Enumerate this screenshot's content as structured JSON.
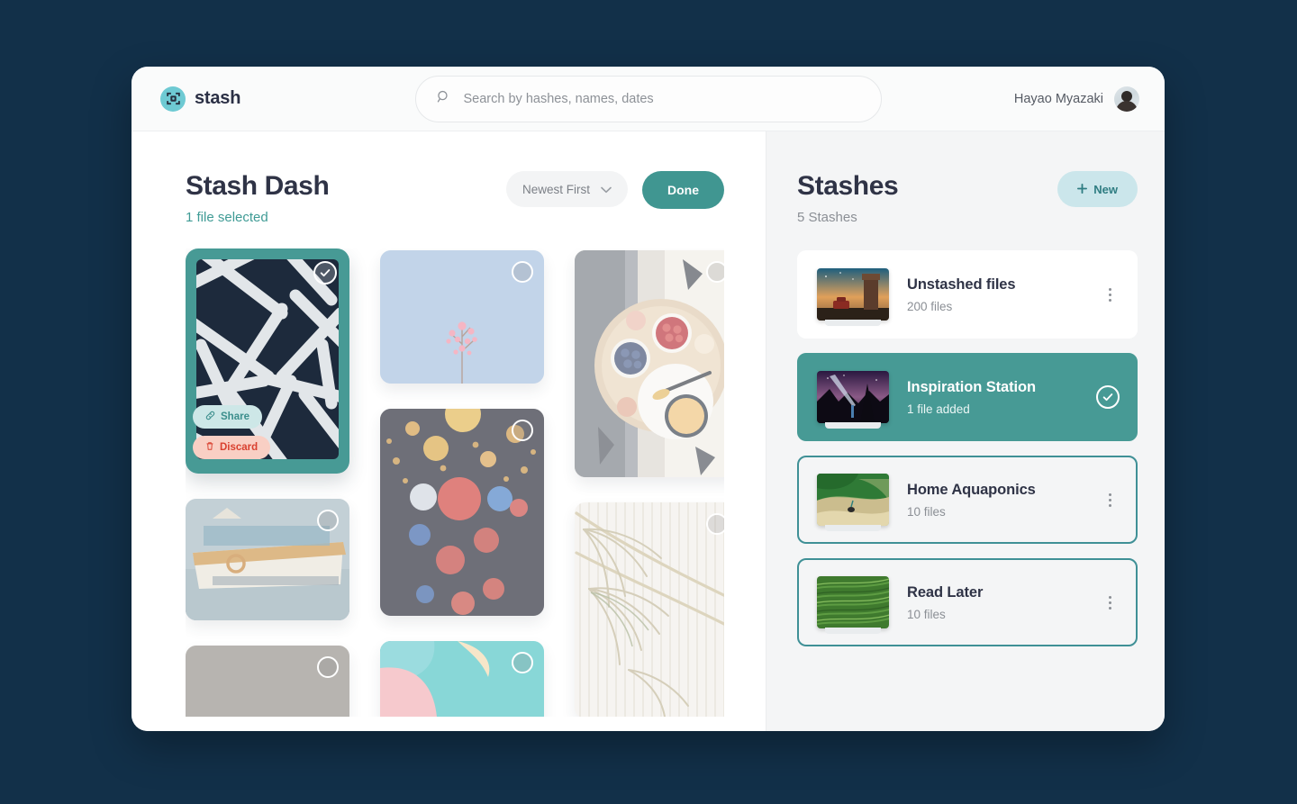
{
  "app": {
    "brand_name": "stash",
    "brand_icon": "stash-logo-icon"
  },
  "header": {
    "search": {
      "icon": "search-icon",
      "placeholder": "Search by hashes, names, dates",
      "value": ""
    },
    "user": {
      "name": "Hayao Myazaki",
      "avatar": "user-avatar"
    }
  },
  "dash": {
    "title": "Stash Dash",
    "subtitle": "1 file selected",
    "sort": {
      "label": "Newest First",
      "chevron": "chevron-down-icon"
    },
    "done_label": "Done",
    "selected_tile": {
      "check_icon": "check-circle-icon",
      "share_label": "Share",
      "share_icon": "link-icon",
      "discard_label": "Discard",
      "discard_icon": "trash-icon"
    },
    "tile_check_icon": "circle-unchecked-icon"
  },
  "stashes": {
    "title": "Stashes",
    "subtitle": "5 Stashes",
    "new_label": "New",
    "new_icon": "plus-icon",
    "menu_icon": "kebab-menu-icon",
    "selected_icon": "check-circle-icon",
    "items": [
      {
        "name": "Unstashed files",
        "count": "200 files",
        "state": "default"
      },
      {
        "name": "Inspiration Station",
        "count": "1 file added",
        "state": "active"
      },
      {
        "name": "Home Aquaponics",
        "count": "10 files",
        "state": "outlined"
      },
      {
        "name": "Read Later",
        "count": "10 files",
        "state": "outlined"
      }
    ]
  },
  "colors": {
    "page_background": "#123049",
    "accent_teal": "#409691",
    "accent_teal_light": "#cbe6eb",
    "discard_red": "#d9402f",
    "discard_bg": "#f9cfc4",
    "panel_gray": "#f4f5f6",
    "text_dark": "#2f3346",
    "text_muted": "#8b8f95"
  }
}
